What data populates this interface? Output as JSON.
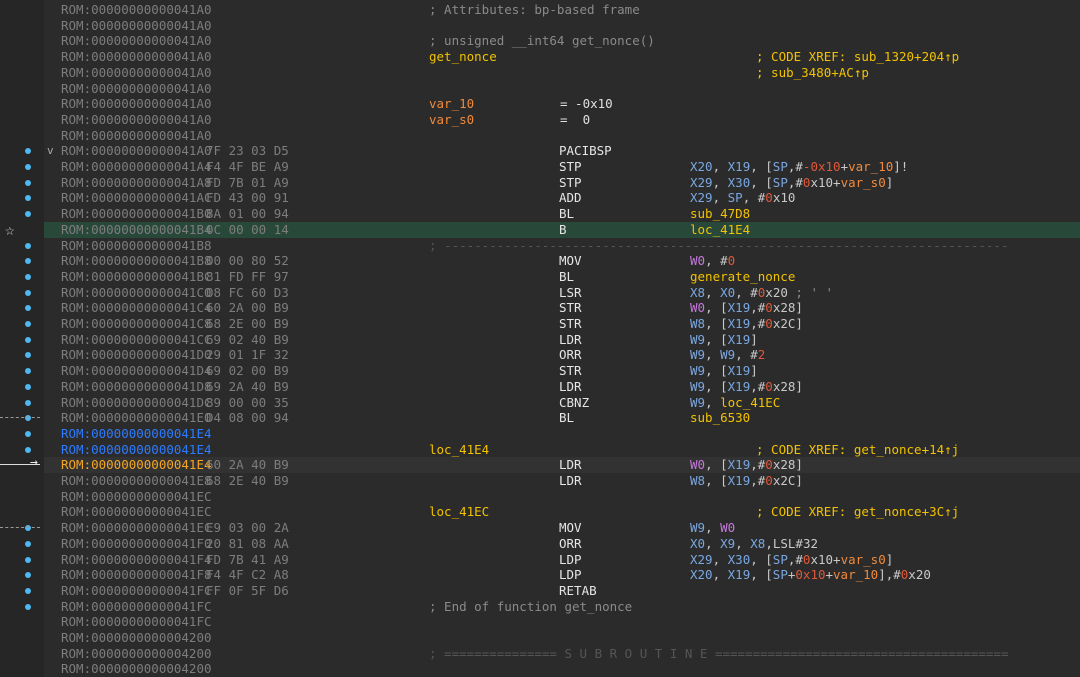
{
  "gutter": {
    "star_glyph": "☆",
    "arrow_glyph": "→"
  },
  "lines": [
    {
      "addr": "ROM:00000000000041A0",
      "cmt": "; Attributes: bp-based frame"
    },
    {
      "addr": "ROM:00000000000041A0"
    },
    {
      "addr": "ROM:00000000000041A0",
      "cmt": "; unsigned __int64 get_nonce()"
    },
    {
      "addr": "ROM:00000000000041A0",
      "label": "get_nonce",
      "xref": "; CODE XREF: sub_1320+204↑p"
    },
    {
      "addr": "ROM:00000000000041A0",
      "xref": "; sub_3480+AC↑p"
    },
    {
      "addr": "ROM:00000000000041A0"
    },
    {
      "addr": "ROM:00000000000041A0",
      "lblorange": "var_10",
      "eq": "= -0x10"
    },
    {
      "addr": "ROM:00000000000041A0",
      "lblorange": "var_s0",
      "eq": "=  0"
    },
    {
      "addr": "ROM:00000000000041A0"
    },
    {
      "addr": "ROM:00000000000041A0",
      "bytes": "7F 23 03 D5",
      "mnem": "PACIBSP",
      "fold": "v"
    },
    {
      "addr": "ROM:00000000000041A4",
      "bytes": "F4 4F BE A9",
      "mnem": "STP",
      "ops": "X20, X19, [SP,#-0x10+var_10]!"
    },
    {
      "addr": "ROM:00000000000041A8",
      "bytes": "FD 7B 01 A9",
      "mnem": "STP",
      "ops": "X29, X30, [SP,#0x10+var_s0]"
    },
    {
      "addr": "ROM:00000000000041AC",
      "bytes": "FD 43 00 91",
      "mnem": "ADD",
      "ops": "X29, SP, #0x10"
    },
    {
      "addr": "ROM:00000000000041B0",
      "bytes": "8A 01 00 94",
      "mnem": "BL",
      "ops": "sub_47D8"
    },
    {
      "addr": "ROM:00000000000041B4",
      "bytes": "0C 00 00 14",
      "mnem": "B",
      "ops": "loc_41E4",
      "hl": true
    },
    {
      "addr": "ROM:00000000000041B8",
      "sep": "; ---------------------------------------------------------------------------"
    },
    {
      "addr": "ROM:00000000000041B8",
      "bytes": "00 00 80 52",
      "mnem": "MOV",
      "ops": "W0, #0"
    },
    {
      "addr": "ROM:00000000000041BC",
      "bytes": "81 FD FF 97",
      "mnem": "BL",
      "ops": "generate_nonce"
    },
    {
      "addr": "ROM:00000000000041C0",
      "bytes": "08 FC 60 D3",
      "mnem": "LSR",
      "ops": "X8, X0, #0x20 ; ' '"
    },
    {
      "addr": "ROM:00000000000041C4",
      "bytes": "60 2A 00 B9",
      "mnem": "STR",
      "ops": "W0, [X19,#0x28]"
    },
    {
      "addr": "ROM:00000000000041C8",
      "bytes": "68 2E 00 B9",
      "mnem": "STR",
      "ops": "W8, [X19,#0x2C]"
    },
    {
      "addr": "ROM:00000000000041CC",
      "bytes": "69 02 40 B9",
      "mnem": "LDR",
      "ops": "W9, [X19]"
    },
    {
      "addr": "ROM:00000000000041D0",
      "bytes": "29 01 1F 32",
      "mnem": "ORR",
      "ops": "W9, W9, #2"
    },
    {
      "addr": "ROM:00000000000041D4",
      "bytes": "69 02 00 B9",
      "mnem": "STR",
      "ops": "W9, [X19]"
    },
    {
      "addr": "ROM:00000000000041D8",
      "bytes": "69 2A 40 B9",
      "mnem": "LDR",
      "ops": "W9, [X19,#0x28]"
    },
    {
      "addr": "ROM:00000000000041DC",
      "bytes": "89 00 00 35",
      "mnem": "CBNZ",
      "ops": "W9, loc_41EC"
    },
    {
      "addr": "ROM:00000000000041E0",
      "bytes": "D4 08 00 94",
      "mnem": "BL",
      "ops": "sub_6530"
    },
    {
      "addr": "ROM:00000000000041E4",
      "addrcls": "blue"
    },
    {
      "addr": "ROM:00000000000041E4",
      "addrcls": "blue",
      "label": "loc_41E4",
      "xref": "; CODE XREF: get_nonce+14↑j"
    },
    {
      "addr": "ROM:00000000000041E4",
      "addrcls": "orange",
      "bytes": "60 2A 40 B9",
      "mnem": "LDR",
      "ops": "W0, [X19,#0x28]",
      "cur": true
    },
    {
      "addr": "ROM:00000000000041E8",
      "bytes": "68 2E 40 B9",
      "mnem": "LDR",
      "ops": "W8, [X19,#0x2C]"
    },
    {
      "addr": "ROM:00000000000041EC"
    },
    {
      "addr": "ROM:00000000000041EC",
      "label": "loc_41EC",
      "xref": "; CODE XREF: get_nonce+3C↑j"
    },
    {
      "addr": "ROM:00000000000041EC",
      "bytes": "E9 03 00 2A",
      "mnem": "MOV",
      "ops": "W9, W0"
    },
    {
      "addr": "ROM:00000000000041F0",
      "bytes": "20 81 08 AA",
      "mnem": "ORR",
      "ops": "X0, X9, X8,LSL#32"
    },
    {
      "addr": "ROM:00000000000041F4",
      "bytes": "FD 7B 41 A9",
      "mnem": "LDP",
      "ops": "X29, X30, [SP,#0x10+var_s0]"
    },
    {
      "addr": "ROM:00000000000041F8",
      "bytes": "F4 4F C2 A8",
      "mnem": "LDP",
      "ops": "X20, X19, [SP+0x10+var_10],#0x20"
    },
    {
      "addr": "ROM:00000000000041FC",
      "bytes": "FF 0F 5F D6",
      "mnem": "RETAB"
    },
    {
      "addr": "ROM:00000000000041FC",
      "cmt": "; End of function get_nonce"
    },
    {
      "addr": "ROM:00000000000041FC"
    },
    {
      "addr": "ROM:0000000000004200"
    },
    {
      "addr": "ROM:0000000000004200",
      "sep": "; =============== S U B R O U T I N E ======================================="
    },
    {
      "addr": "ROM:0000000000004200"
    }
  ]
}
